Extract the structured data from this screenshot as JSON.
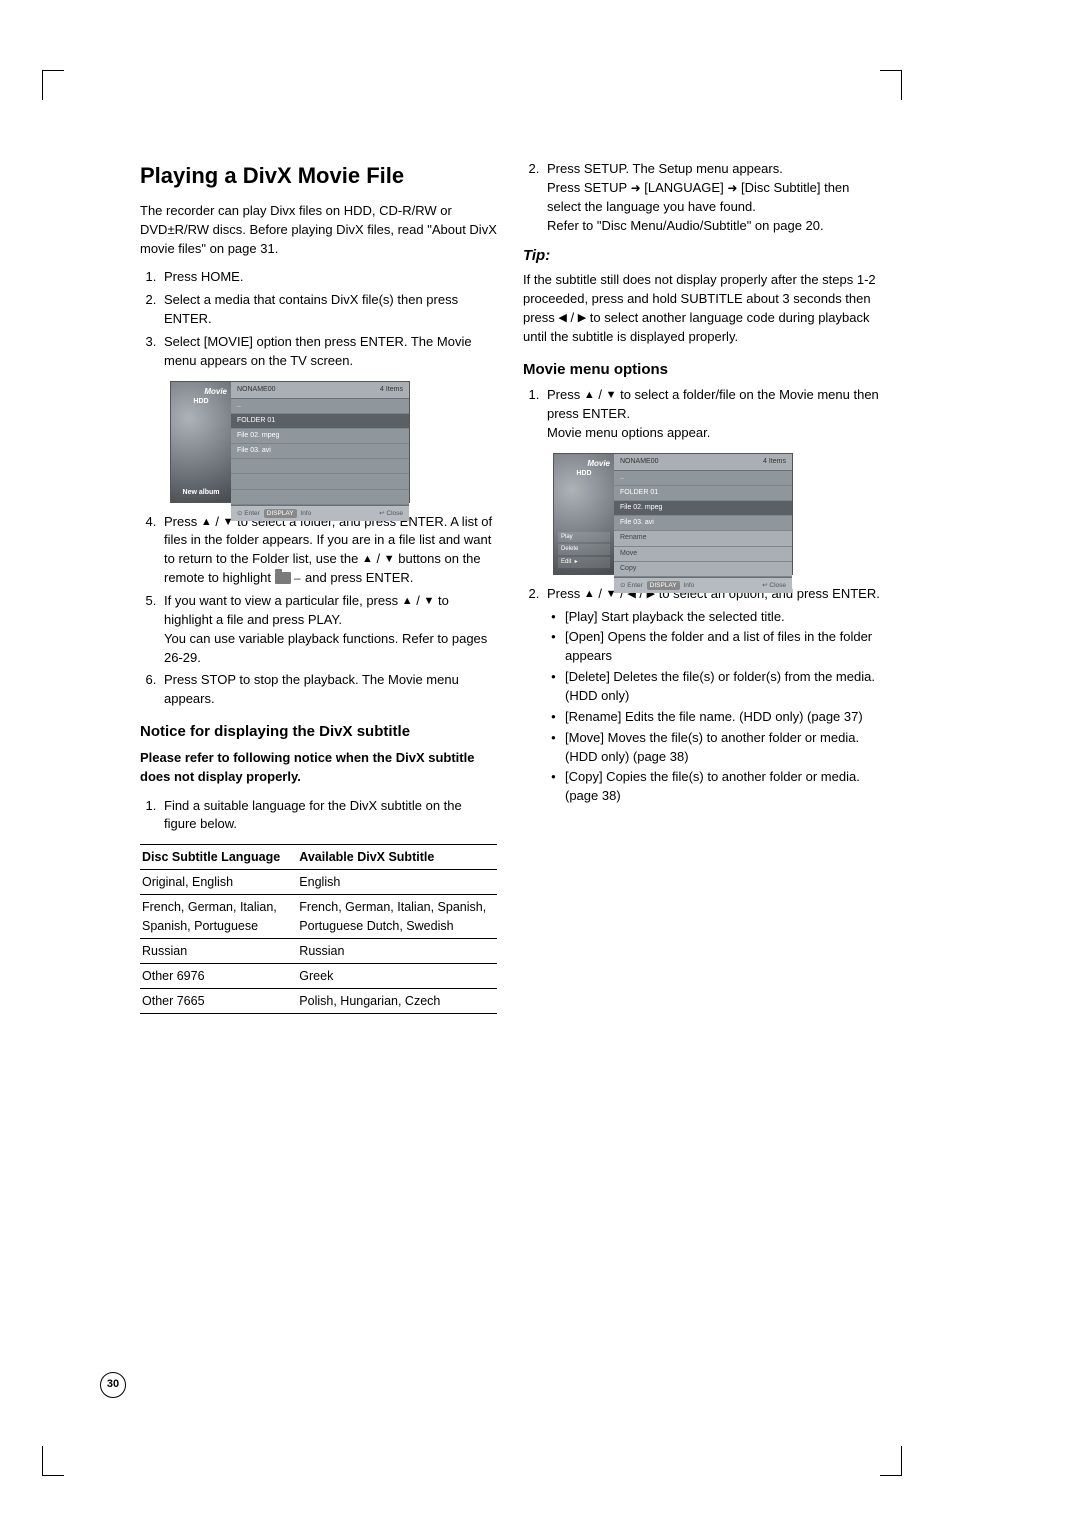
{
  "page_number": "30",
  "left": {
    "h1": "Playing a DivX Movie File",
    "intro": "The recorder can play Divx files on HDD, CD-R/RW or DVD±R/RW discs. Before playing DivX files, read \"About DivX movie files\" on page 31.",
    "steps": [
      "Press HOME.",
      "Select a media that contains DivX file(s) then press ENTER.",
      "Select [MOVIE] option then press ENTER. The Movie menu appears on the TV screen."
    ],
    "shot1": {
      "side_title": "Movie",
      "hdd": "HDD",
      "new_album": "New album",
      "title_bar": "NONAME00",
      "count": "4 Items",
      "rows": [
        "..",
        "FOLDER 01",
        "File 02. mpeg",
        "File 03. avi"
      ],
      "foot_left": "Enter",
      "foot_mid": "Info",
      "foot_right": "Close"
    },
    "step4_a": "Press ",
    "step4_b": " to select a folder, and press ENTER. A list of files in the folder appears. If you are in a file list and want to return to the Folder list, use the ",
    "step4_c": " buttons on the remote to highlight ",
    "step4_d": " and press ENTER.",
    "step5_a": "If you want to view a particular file, press ",
    "step5_b": " to highlight a file and press PLAY.",
    "step5_c": "You can use variable playback functions. Refer to pages 26-29.",
    "step6": "Press STOP to stop the playback. The Movie menu appears.",
    "h2_notice": "Notice for displaying the DivX subtitle",
    "notice_bold": "Please refer to following notice when the DivX subtitle does not display properly.",
    "notice_step1": "Find a suitable language for the DivX subtitle on the figure below.",
    "table": {
      "head": [
        "Disc Subtitle Language",
        "Available DivX Subtitle"
      ],
      "rows": [
        [
          "Original, English",
          "English"
        ],
        [
          "French, German, Italian, Spanish, Portuguese",
          "French, German, Italian, Spanish, Portuguese Dutch, Swedish"
        ],
        [
          "Russian",
          "Russian"
        ],
        [
          "Other 6976",
          "Greek"
        ],
        [
          "Other 7665",
          "Polish, Hungarian, Czech"
        ]
      ]
    }
  },
  "right": {
    "step2_a": "Press SETUP. The Setup menu appears.",
    "step2_b1": "Press SETUP ",
    "step2_b2": " [LANGUAGE] ",
    "step2_b3": " [Disc Subtitle] then select the language you have found.",
    "step2_c": "Refer to \"Disc Menu/Audio/Subtitle\" on page 20.",
    "tip_label": "Tip:",
    "tip_body_a": "If the subtitle still does not display properly after the steps 1-2 proceeded, press and hold SUBTITLE about 3 seconds then press ",
    "tip_body_b": " to select another language code during playback until the subtitle is displayed properly.",
    "h2_movie": "Movie menu options",
    "m_step1_a": "Press ",
    "m_step1_b": " to select a folder/file on the Movie menu then press ENTER.",
    "m_step1_c": "Movie menu options appear.",
    "shot2": {
      "side_title": "Movie",
      "hdd": "HDD",
      "menu": [
        "Play",
        "Delete",
        "Edit"
      ],
      "title_bar": "NONAME00",
      "count": "4 Items",
      "rows": [
        "..",
        "FOLDER 01",
        "File 02. mpeg",
        "File 03. avi",
        "Rename",
        "Move",
        "Copy"
      ],
      "foot_left": "Enter",
      "foot_mid": "Info",
      "foot_right": "Close"
    },
    "m_step2_a": "Press ",
    "m_step2_b": " to select an option, and press ENTER.",
    "bullets": [
      "[Play] Start playback the selected title.",
      "[Open] Opens the folder and a list of files in the folder appears",
      "[Delete] Deletes the file(s) or folder(s) from the media. (HDD only)",
      "[Rename] Edits the file name. (HDD only) (page 37)",
      "[Move] Moves the file(s) to another folder or media. (HDD only) (page 38)",
      "[Copy] Copies the file(s) to another folder or media. (page 38)"
    ]
  },
  "glyphs": {
    "up": "▲",
    "down": "▼",
    "left": "◀",
    "right": "▶",
    "slash": " / ",
    "rarrow": "➜"
  }
}
